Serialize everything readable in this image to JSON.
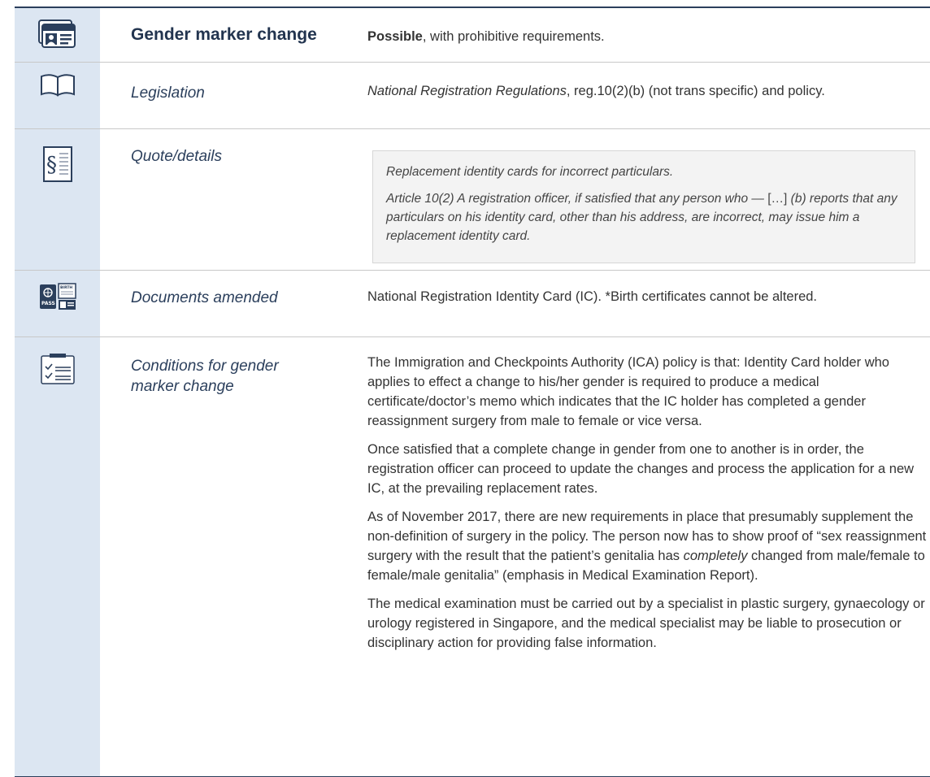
{
  "header": {
    "title": "Gender marker change",
    "summary_bold": "Possible",
    "summary_rest": ", with prohibitive requirements."
  },
  "legislation": {
    "label": "Legislation",
    "act": "National Registration Regulations",
    "detail": ", reg.10(2)(b) (not trans specific) and policy."
  },
  "quote": {
    "label": "Quote/details",
    "p1": "Replacement identity cards for incorrect particulars.",
    "p2a": "Article 10(2) A registration officer, if satisfied that any person who —",
    "p2b": " […] ",
    "p2c": "(b) reports that any particulars on his identity card, other than his address, are incorrect, may issue him a replacement identity card."
  },
  "documents": {
    "label": "Documents amended",
    "text": "National Registration Identity Card (IC). *Birth certificates cannot be altered."
  },
  "conditions": {
    "label": "Conditions for gender marker change",
    "p1": "The Immigration and Checkpoints Authority (ICA) policy is that: Identity Card holder who applies to effect a change to his/her gender is required to produce a medical certificate/doctor’s memo which indicates that the IC holder has completed a gender reassignment surgery from male to female or vice versa.",
    "p2": "Once satisfied that a complete change in gender from one to another is in order, the registration officer can proceed to update the changes and process the application for a new IC, at the prevailing replacement rates.",
    "p3a": "As of November 2017, there are new requirements in place that presumably supplement the non-definition of surgery in the policy. The person now has to show proof of “sex reassignment surgery with the result that the patient’s genitalia has ",
    "p3em": "completely",
    "p3b": " changed from male/female to female/male genitalia” (emphasis in Medical Examination Report).",
    "p4": "The medical examination must be carried out by a specialist in plastic surgery, gynaecology or urology registered in Singapore, and the medical specialist may be liable to prosecution or disciplinary action for providing false information."
  },
  "icons": {
    "id_card": "id-card-icon",
    "book": "book-icon",
    "section": "section-sign-icon",
    "section_glyph": "§",
    "passport": "passport-birth-certificate-icon",
    "pass_label": "PASS",
    "birth_label": "BIRTH",
    "checklist": "checklist-icon"
  },
  "colors": {
    "accent": "#2b3f5c",
    "icon_column": "#dce6f2"
  }
}
